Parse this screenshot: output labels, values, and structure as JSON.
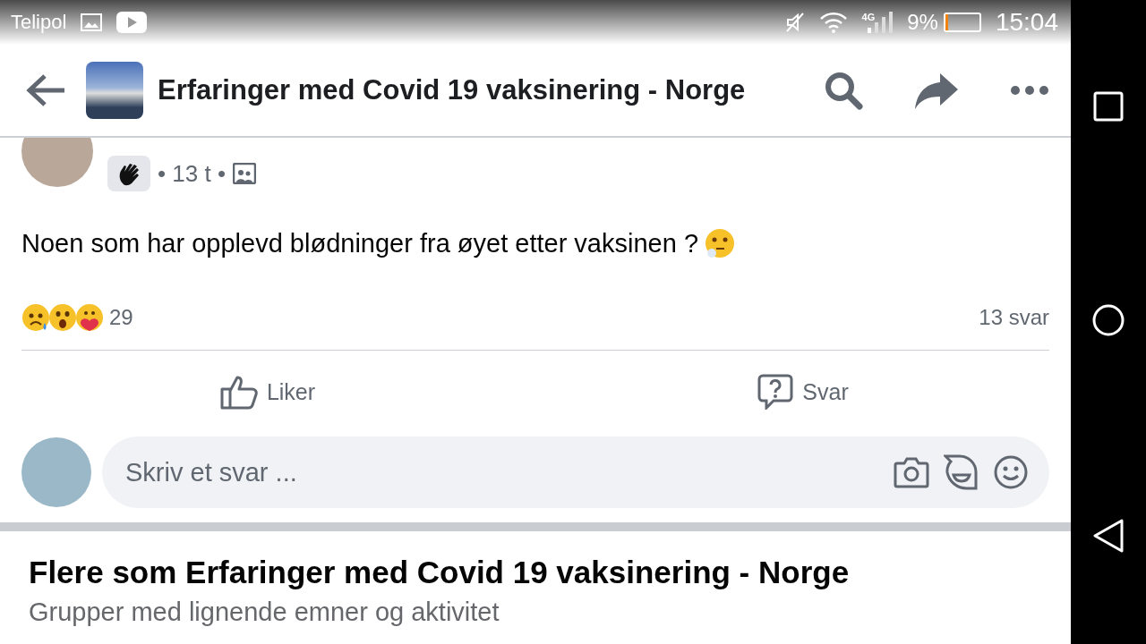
{
  "status_bar": {
    "carrier": "Telipol",
    "network": "4G",
    "battery_percent": "9%",
    "battery": {
      "level": 0.09
    },
    "time": "15:04"
  },
  "header": {
    "title": "Erfaringer med Covid 19 vaksinering - Norge"
  },
  "post": {
    "time": "• 13 t •",
    "text": "Noen som har opplevd blødninger fra øyet etter vaksinen ?",
    "reaction_count": "29",
    "reply_count": "13 svar",
    "actions": [
      {
        "kind": "like",
        "label": "Liker"
      },
      {
        "kind": "reply",
        "label": "Svar"
      }
    ]
  },
  "reply_field": {
    "placeholder": "Skriv et svar ..."
  },
  "suggestions": {
    "title": "Flere som Erfaringer med Covid 19 vaksinering - Norge",
    "subtitle": "Grupper med lignende emner og aktivitet"
  }
}
